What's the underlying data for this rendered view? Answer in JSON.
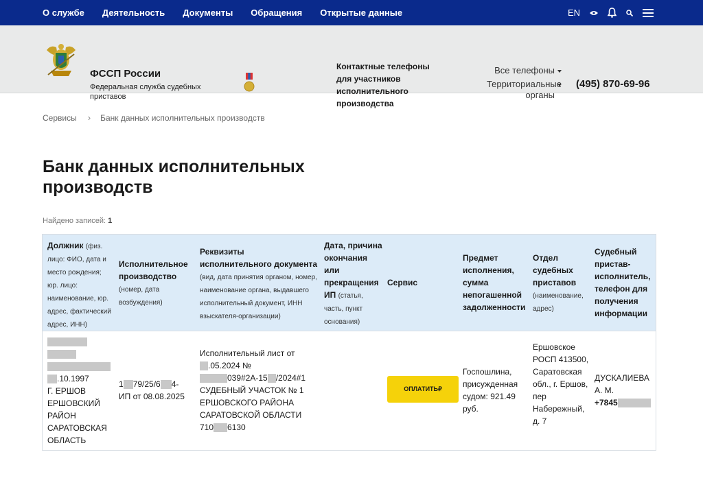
{
  "topnav": {
    "links": [
      "О службе",
      "Деятельность",
      "Документы",
      "Обращения",
      "Открытые данные"
    ],
    "lang": "EN",
    "icons": [
      "eye-icon",
      "bell-icon",
      "search-icon",
      "menu-icon"
    ]
  },
  "header": {
    "org_name": "ФССП России",
    "org_full": "Федеральная служба судебных приставов",
    "contacts_title": "Контактные телефоны для участников исполнительного производства",
    "all_phones": "Все телефоны",
    "territorial": "Территориальные органы",
    "main_phone": "(495) 870-69-96"
  },
  "breadcrumb": {
    "root": "Сервисы",
    "current": "Банк данных исполнительных производств"
  },
  "page_title": "Банк данных исполнительных производств",
  "found": {
    "label": "Найдено записей:",
    "count": "1"
  },
  "table": {
    "headers": {
      "debtor": "Должник",
      "debtor_note": "(физ. лицо: ФИО, дата и место рождения; юр. лицо: наименование, юр. адрес, фактический адрес, ИНН)",
      "proceeding": "Исполнительное производство",
      "proceeding_note": "(номер, дата возбуждения)",
      "doc": "Реквизиты исполнительного документа",
      "doc_note": "(вид, дата принятия органом, номер, наименование органа, выдавшего исполнительный документ, ИНН взыскателя-организации)",
      "end": "Дата, причина окончания или прекращения ИП",
      "end_note": "(статья, часть, пункт основания)",
      "service": "Сервис",
      "subject": "Предмет исполнения, сумма непогашенной задолженности",
      "dept": "Отдел судебных приставов",
      "dept_note": "(наименование, адрес)",
      "bailiff": "Судебный пристав-исполнитель, телефон для получения информации"
    },
    "row": {
      "debtor_date": ".10.1997",
      "debtor_place": "Г. ЕРШОВ ЕРШОВСКИЙ РАЙОН САРАТОВСКАЯ ОБЛАСТЬ",
      "proc_a": "1",
      "proc_b": "79/25/6",
      "proc_c": "4-",
      "proc_d": "ИП от 08.08.2025",
      "doc_a": "Исполнительный лист от",
      "doc_b": ".05.2024 №",
      "doc_c": "039#2А-15",
      "doc_d": "/2024#1",
      "doc_e": "СУДЕБНЫЙ УЧАСТОК № 1 ЕРШОВСКОГО РАЙОНА САРАТОВСКОЙ ОБЛАСТИ",
      "doc_f": "710",
      "doc_g": "6130",
      "pay_label": "ОПЛАТИТЬ₽",
      "subject": "Госпошлина, присужденная судом: 921.49 руб.",
      "dept": "Ершовское РОСП 413500, Саратовская обл., г. Ершов, пер Набережный, д. 7",
      "bailiff_name": "ДУСКАЛИЕВА А. М.",
      "bailiff_phone": "+7845"
    }
  },
  "colors": {
    "nav_bg": "#0a2a8c",
    "header_bg": "#e9eaea",
    "table_head_bg": "#dcebf8",
    "pay_button": "#f5d20a"
  }
}
